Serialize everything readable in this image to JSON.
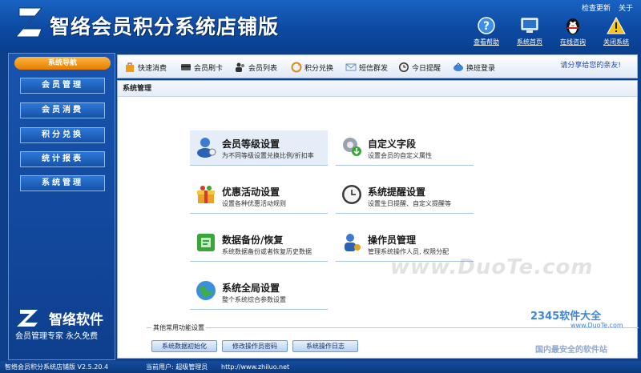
{
  "header": {
    "title": "智络会员积分系统店铺版",
    "top_links": [
      "检查更新",
      "关于"
    ],
    "buttons": [
      "查看帮助",
      "系统首页",
      "在线咨询",
      "关闭系统"
    ]
  },
  "sidebar": {
    "head": "系统导航",
    "items": [
      "会员管理",
      "会员消费",
      "积分兑换",
      "统计报表",
      "系统管理"
    ],
    "brand": "智络软件",
    "slogan": "会员管理专家 永久免费"
  },
  "toolbar": {
    "items": [
      "快速消费",
      "会员刷卡",
      "会员列表",
      "积分兑换",
      "短信群发",
      "今日提醒",
      "换班登录"
    ],
    "share": "请分享给您的亲友!"
  },
  "content": {
    "title": "系统管理",
    "panels": [
      {
        "title": "会员等级设置",
        "desc": "为不同等级设置兑换比例/折扣率"
      },
      {
        "title": "自定义字段",
        "desc": "设置会员的自定义属性"
      },
      {
        "title": "优惠活动设置",
        "desc": "设置各种优惠活动规则"
      },
      {
        "title": "系统提醒设置",
        "desc": "设置生日提醒、自定义提醒等"
      },
      {
        "title": "数据备份/恢复",
        "desc": "系统数据备份或者恢复历史数据"
      },
      {
        "title": "操作员管理",
        "desc": "管理系统操作人员, 权限分配"
      },
      {
        "title": "系统全局设置",
        "desc": "整个系统综合参数设置"
      }
    ],
    "common_title": "其他常用功能设置",
    "common_buttons": [
      "系统数据初始化",
      "修改操作员密码",
      "系统操作日志"
    ],
    "watermark": "www.DuoTe.com"
  },
  "footer": {
    "version": "智络会员积分系统店铺版 V2.5.20.4",
    "user": "当前用户: 超级管理员",
    "url": "http://www.zhiluo.net"
  },
  "badge": {
    "line1": "2345软件大全",
    "line2": "www.DuoTe.com",
    "line3": "国内最安全的软件站"
  },
  "colors": {
    "header_bg": "#0c4aa3",
    "nav_head": "#f29a1a",
    "accent_link": "#1b44c9"
  }
}
